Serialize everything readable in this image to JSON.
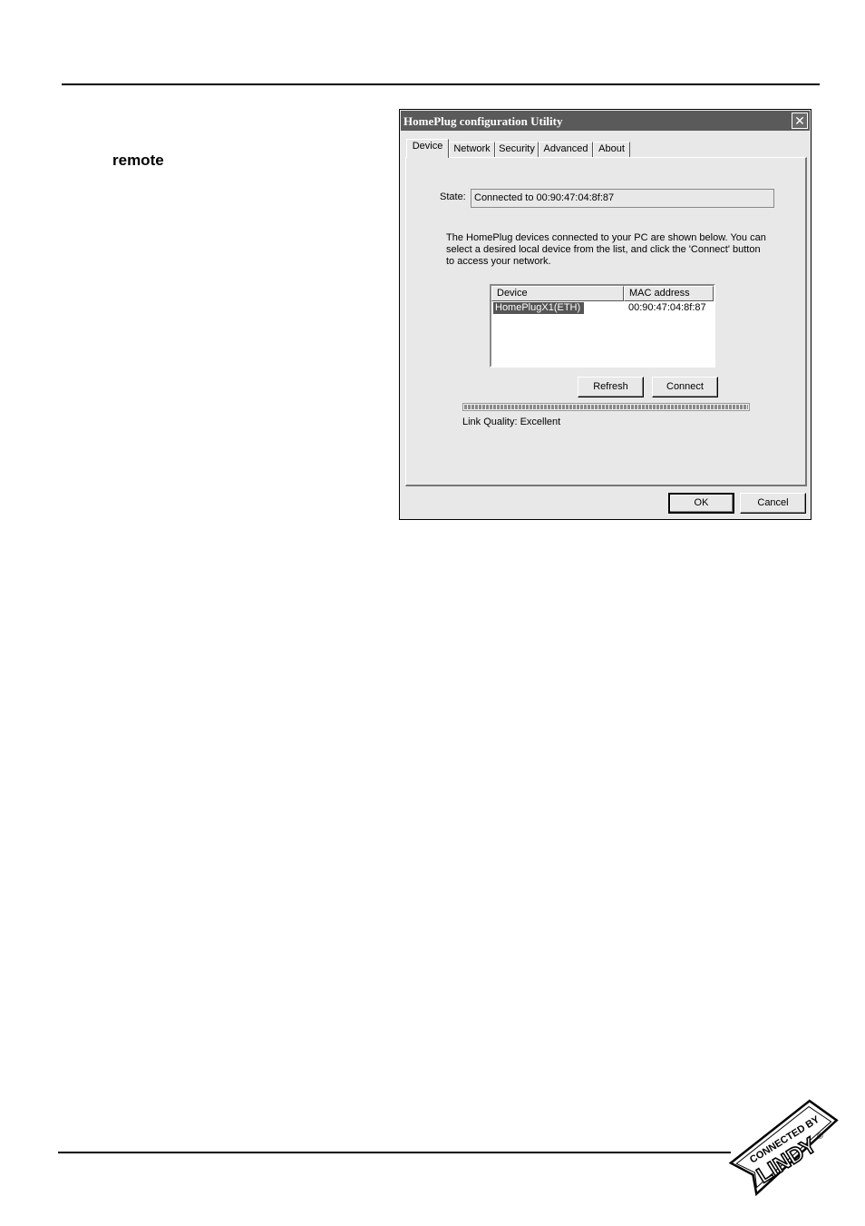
{
  "page": {
    "keyword": "remote"
  },
  "dialog": {
    "title": "HomePlug configuration Utility",
    "close_glyph": "✕",
    "tabs": [
      {
        "label": "Device",
        "active": true
      },
      {
        "label": "Network",
        "active": false
      },
      {
        "label": "Security",
        "active": false
      },
      {
        "label": "Advanced",
        "active": false
      },
      {
        "label": "About",
        "active": false
      }
    ],
    "state": {
      "label": "State:",
      "value": "Connected to 00:90:47:04:8f:87"
    },
    "description": "The HomePlug devices connected to your PC are shown below.  You can select a desired local device from the list, and click the 'Connect' button to access your network.",
    "device_list": {
      "columns": [
        "Device",
        "MAC address"
      ],
      "rows": [
        {
          "device": "HomePlugX1(ETH)",
          "mac": "00:90:47:04:8f:87",
          "selected": true
        }
      ]
    },
    "buttons": {
      "refresh": "Refresh",
      "connect": "Connect",
      "ok": "OK",
      "cancel": "Cancel"
    },
    "link_quality": {
      "text": "Link Quality: Excellent",
      "level": 1.0
    }
  },
  "logo": {
    "text_top": "CONNECTED BY",
    "text_main": "LINDY",
    "mark": "®"
  }
}
